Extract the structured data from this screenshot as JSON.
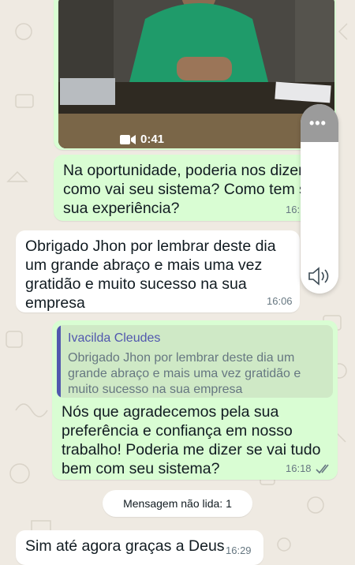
{
  "video": {
    "duration": "0:41",
    "time": "16"
  },
  "messages": [
    {
      "text": "Na oportunidade, poderia nos dizer como vai seu sistema? Como tem si sua experiência?",
      "time": "16:"
    },
    {
      "text": "Obrigado  Jhon  por lembrar deste dia um grande abraço e mais uma vez gratidão e muito sucesso  na sua empresa",
      "time": "16:06"
    },
    {
      "quote_author": "Ivacilda Cleudes",
      "quote_text": "Obrigado  Jhon  por lembrar deste dia um grande abraço e mais uma vez gratidão e muito sucesso  na sua empresa",
      "text": "Nós que agradecemos pela sua preferência e confiança em nosso trabalho! Poderia me dizer se vai tudo bem com seu sistema?",
      "time": "16:18"
    },
    {
      "text": "Sim até agora graças a Deus",
      "time": "16:29"
    }
  ],
  "unread_label": "Mensagem não lida: 1",
  "icons": {
    "camera": "video-camera-icon",
    "ticks": "double-check-icon",
    "more": "more-dots-icon",
    "speaker": "speaker-icon"
  },
  "colors": {
    "wallpaper": "#efeae2",
    "outgoing": "#d9fdd3",
    "incoming": "#ffffff",
    "quote_accent": "#5157ae",
    "read_ticks": "#667781"
  }
}
